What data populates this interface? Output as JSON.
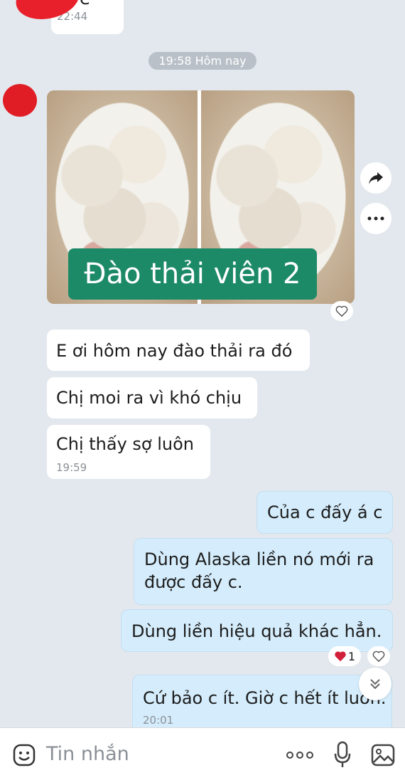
{
  "top_message": {
    "text": "X e",
    "time": "22:44"
  },
  "date_pill": "19:58 Hôm nay",
  "image": {
    "caption": "Đào thải viên 2"
  },
  "incoming": [
    {
      "text": "E ơi hôm nay đào thải ra đó"
    },
    {
      "text": "Chị moi ra vì khó chịu"
    },
    {
      "text": "Chị thấy sợ luôn",
      "time": "19:59"
    }
  ],
  "outgoing": [
    {
      "text": "Của c đấy á c"
    },
    {
      "text": "Dùng Alaska liền nó mới ra được đấy c."
    },
    {
      "text": "Dùng liền hiệu quả khác hẳn.",
      "reaction_count": "1"
    },
    {
      "text": "Cứ bảo c ít. Giờ c hết ít luôn.",
      "time": "20:01"
    }
  ],
  "composer": {
    "placeholder": "Tin nhắn"
  },
  "colors": {
    "caption_bg": "#1d8a67",
    "bubble_out": "#d4ecfb",
    "bubble_in": "#ffffff",
    "heart": "#d3203a"
  },
  "icons": [
    "share-arrow-icon",
    "more-dots-icon",
    "heart-outline-icon",
    "heart-filled-icon",
    "chevron-double-down-icon",
    "emoji-icon",
    "dots-icon",
    "microphone-icon",
    "image-icon"
  ]
}
